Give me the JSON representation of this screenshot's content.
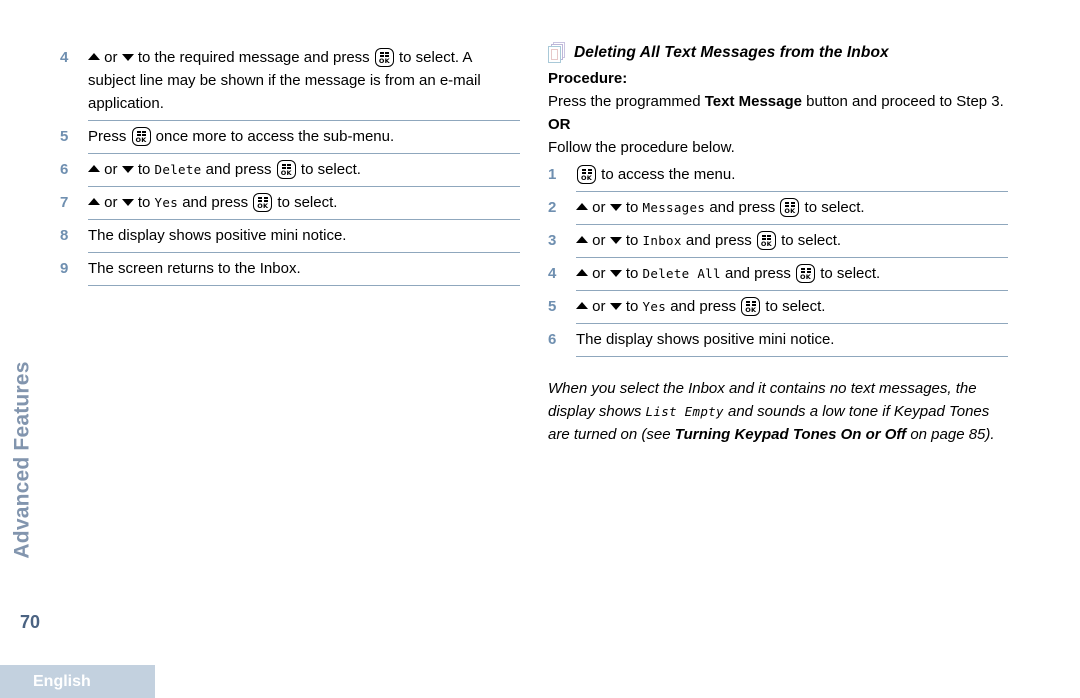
{
  "page": {
    "number": "70",
    "chapter_tab": "Advanced Features",
    "language": "English"
  },
  "left_column": {
    "steps": [
      {
        "num": "4",
        "parts": [
          {
            "t": "arrow-up"
          },
          {
            "t": "text",
            "v": " or "
          },
          {
            "t": "arrow-down"
          },
          {
            "t": "text",
            "v": " to the required message and press "
          },
          {
            "t": "ok-key"
          },
          {
            "t": "text",
            "v": " to select. A subject line may be shown if the message is from an e-mail application."
          }
        ]
      },
      {
        "num": "5",
        "parts": [
          {
            "t": "text",
            "v": "Press "
          },
          {
            "t": "ok-key"
          },
          {
            "t": "text",
            "v": " once more to access the sub-menu."
          }
        ]
      },
      {
        "num": "6",
        "parts": [
          {
            "t": "arrow-up"
          },
          {
            "t": "text",
            "v": " or "
          },
          {
            "t": "arrow-down"
          },
          {
            "t": "text",
            "v": " to "
          },
          {
            "t": "mono",
            "v": "Delete"
          },
          {
            "t": "text",
            "v": " and press "
          },
          {
            "t": "ok-key"
          },
          {
            "t": "text",
            "v": " to select."
          }
        ]
      },
      {
        "num": "7",
        "parts": [
          {
            "t": "arrow-up"
          },
          {
            "t": "text",
            "v": " or "
          },
          {
            "t": "arrow-down"
          },
          {
            "t": "text",
            "v": " to "
          },
          {
            "t": "mono",
            "v": "Yes"
          },
          {
            "t": "text",
            "v": " and press "
          },
          {
            "t": "ok-key"
          },
          {
            "t": "text",
            "v": " to select."
          }
        ]
      },
      {
        "num": "8",
        "parts": [
          {
            "t": "text",
            "v": "The display shows positive mini notice."
          }
        ]
      },
      {
        "num": "9",
        "parts": [
          {
            "t": "text",
            "v": "The screen returns to the Inbox."
          }
        ]
      }
    ]
  },
  "right_column": {
    "heading": "Deleting All Text Messages from the Inbox",
    "heading_icon": "documents-icon",
    "intro": {
      "procedure_label": "Procedure:",
      "line_parts": [
        {
          "t": "text",
          "v": "Press the programmed "
        },
        {
          "t": "bold",
          "v": "Text Message"
        },
        {
          "t": "text",
          "v": " button and proceed to Step 3."
        }
      ],
      "or_label": "OR",
      "follow_line": "Follow the procedure below."
    },
    "steps": [
      {
        "num": "1",
        "parts": [
          {
            "t": "ok-key"
          },
          {
            "t": "text",
            "v": " to access the menu."
          }
        ]
      },
      {
        "num": "2",
        "parts": [
          {
            "t": "arrow-up"
          },
          {
            "t": "text",
            "v": " or "
          },
          {
            "t": "arrow-down"
          },
          {
            "t": "text",
            "v": " to "
          },
          {
            "t": "mono",
            "v": "Messages"
          },
          {
            "t": "text",
            "v": " and press "
          },
          {
            "t": "ok-key"
          },
          {
            "t": "text",
            "v": " to select."
          }
        ]
      },
      {
        "num": "3",
        "parts": [
          {
            "t": "arrow-up"
          },
          {
            "t": "text",
            "v": " or "
          },
          {
            "t": "arrow-down"
          },
          {
            "t": "text",
            "v": " to "
          },
          {
            "t": "mono",
            "v": "Inbox"
          },
          {
            "t": "text",
            "v": " and press "
          },
          {
            "t": "ok-key"
          },
          {
            "t": "text",
            "v": " to select."
          }
        ]
      },
      {
        "num": "4",
        "parts": [
          {
            "t": "arrow-up"
          },
          {
            "t": "text",
            "v": " or "
          },
          {
            "t": "arrow-down"
          },
          {
            "t": "text",
            "v": " to "
          },
          {
            "t": "mono",
            "v": "Delete All"
          },
          {
            "t": "text",
            "v": " and press "
          },
          {
            "t": "ok-key"
          },
          {
            "t": "text",
            "v": " to select."
          }
        ]
      },
      {
        "num": "5",
        "parts": [
          {
            "t": "arrow-up"
          },
          {
            "t": "text",
            "v": " or "
          },
          {
            "t": "arrow-down"
          },
          {
            "t": "text",
            "v": " to "
          },
          {
            "t": "mono",
            "v": "Yes"
          },
          {
            "t": "text",
            "v": " and press "
          },
          {
            "t": "ok-key"
          },
          {
            "t": "text",
            "v": " to select."
          }
        ]
      },
      {
        "num": "6",
        "parts": [
          {
            "t": "text",
            "v": "The display shows positive mini notice."
          }
        ]
      }
    ],
    "note_parts": [
      {
        "t": "text",
        "v": "When you select the Inbox and it contains no text messages, the display shows "
      },
      {
        "t": "mono",
        "v": "List Empty"
      },
      {
        "t": "text",
        "v": " and sounds a low tone if Keypad Tones are turned on (see "
      },
      {
        "t": "bold",
        "v": "Turning Keypad Tones On or Off"
      },
      {
        "t": "text",
        "v": " on page 85)."
      }
    ]
  }
}
